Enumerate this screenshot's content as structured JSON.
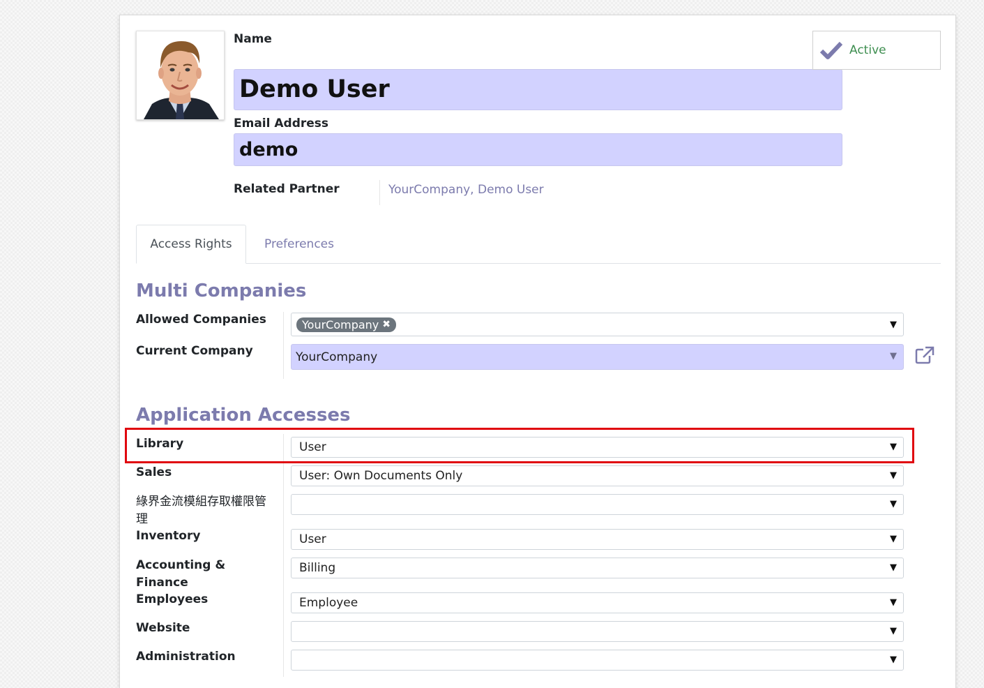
{
  "header": {
    "name_label": "Name",
    "name_value": "Demo User",
    "email_label": "Email Address",
    "email_value": "demo",
    "active_label": "Active",
    "related_partner_label": "Related Partner",
    "related_partner_value": "YourCompany, Demo User"
  },
  "tabs": [
    {
      "label": "Access Rights",
      "active": true
    },
    {
      "label": "Preferences",
      "active": false
    }
  ],
  "multi_companies": {
    "title": "Multi Companies",
    "allowed_label": "Allowed Companies",
    "allowed_tags": [
      "YourCompany"
    ],
    "current_label": "Current Company",
    "current_value": "YourCompany"
  },
  "application_accesses": {
    "title": "Application Accesses",
    "rows": [
      {
        "label": "Library",
        "value": "User"
      },
      {
        "label": "Sales",
        "value": "User: Own Documents Only"
      },
      {
        "label": "綠界金流模組存取權限管理",
        "value": ""
      },
      {
        "label": "Inventory",
        "value": "User"
      },
      {
        "label": "Accounting & Finance",
        "value": "Billing"
      },
      {
        "label": "Employees",
        "value": "Employee"
      },
      {
        "label": "Website",
        "value": ""
      },
      {
        "label": "Administration",
        "value": ""
      }
    ]
  },
  "icons": {
    "active": "checkmark-icon",
    "external": "external-link-icon",
    "dropdown": "caret-down-icon"
  },
  "colors": {
    "accent": "#7c7bad",
    "input_highlight": "#d2d2ff",
    "active_text": "#3e8e50",
    "annotation": "#e0060f"
  }
}
